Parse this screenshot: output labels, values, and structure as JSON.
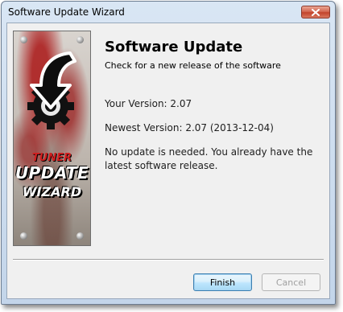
{
  "window": {
    "title": "Software Update Wizard"
  },
  "banner": {
    "line1": "TUNER",
    "line2": "UPDATE",
    "line3": "WIZARD"
  },
  "header": {
    "title": "Software Update",
    "subtitle": "Check for a new release of the software"
  },
  "info": {
    "your_version": "Your Version: 2.07",
    "newest_version": "Newest Version: 2.07 (2013-12-04)",
    "message": "No update is needed. You already have the latest software release."
  },
  "buttons": {
    "finish": "Finish",
    "cancel": "Cancel"
  },
  "colors": {
    "close_button": "#c2442c",
    "default_button_border": "#3c7fb1"
  }
}
